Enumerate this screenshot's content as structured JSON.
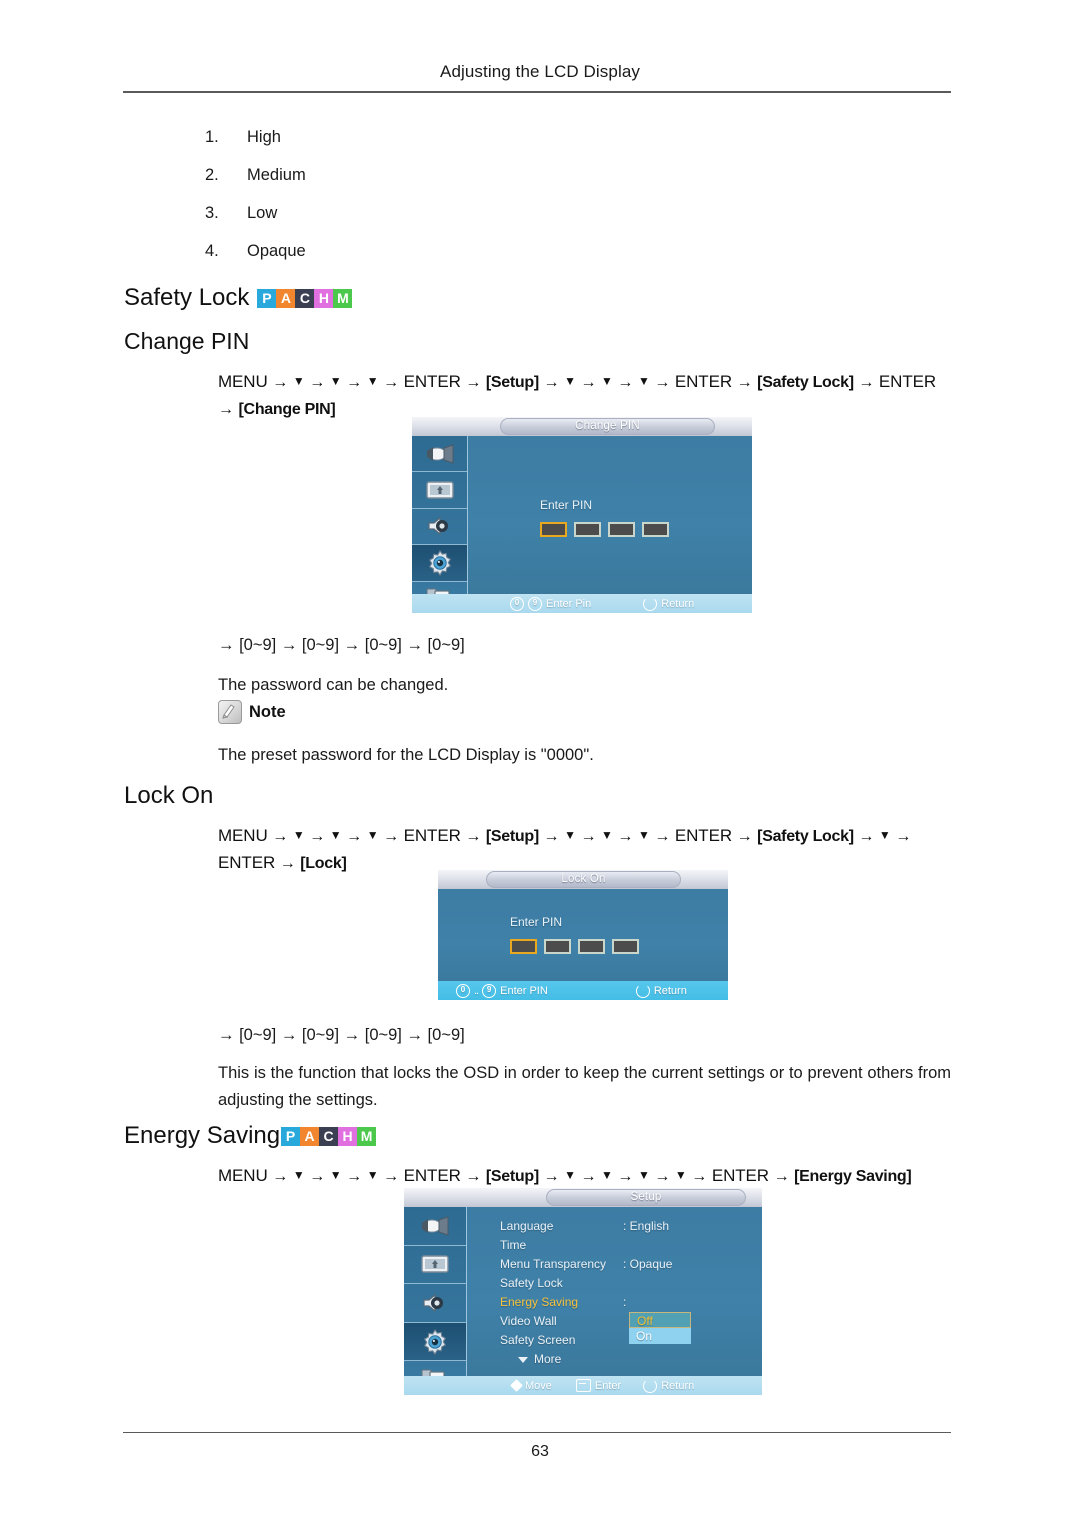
{
  "header": {
    "title": "Adjusting the LCD Display"
  },
  "footer": {
    "page_number": "63"
  },
  "numbered_list": [
    {
      "index": "1.",
      "label": "High"
    },
    {
      "index": "2.",
      "label": "Medium"
    },
    {
      "index": "3.",
      "label": "Low"
    },
    {
      "index": "4.",
      "label": "Opaque"
    }
  ],
  "badges": {
    "letters": [
      "P",
      "A",
      "C",
      "H",
      "M"
    ],
    "colors": [
      "#29a8dc",
      "#f2862e",
      "#3b3f52",
      "#e06fe0",
      "#4cc84c"
    ]
  },
  "sections": {
    "safety_lock": {
      "heading": "Safety Lock",
      "subheading": "Change PIN",
      "menu_path": {
        "line1": [
          {
            "t": "MENU",
            "k": "kw"
          },
          {
            "t": "→",
            "k": "arw"
          },
          {
            "t": "▼",
            "k": "dn"
          },
          {
            "t": "→",
            "k": "arw"
          },
          {
            "t": "▼",
            "k": "dn"
          },
          {
            "t": "→",
            "k": "arw"
          },
          {
            "t": "▼",
            "k": "dn"
          },
          {
            "t": "→",
            "k": "arw"
          },
          {
            "t": "ENTER",
            "k": "kw"
          },
          {
            "t": "→",
            "k": "arw"
          },
          {
            "t": "[Setup]",
            "k": "brk"
          },
          {
            "t": "→",
            "k": "arw"
          },
          {
            "t": "▼",
            "k": "dn"
          },
          {
            "t": "→",
            "k": "arw"
          },
          {
            "t": "▼",
            "k": "dn"
          },
          {
            "t": "→",
            "k": "arw"
          },
          {
            "t": "▼",
            "k": "dn"
          },
          {
            "t": "→",
            "k": "arw"
          },
          {
            "t": "ENTER",
            "k": "kw"
          },
          {
            "t": "→",
            "k": "arw"
          },
          {
            "t": "[Safety Lock]",
            "k": "brk"
          },
          {
            "t": "→",
            "k": "arw"
          },
          {
            "t": "ENTER",
            "k": "kw"
          }
        ],
        "line2": [
          {
            "t": "→",
            "k": "arw"
          },
          {
            "t": "[Change PIN]",
            "k": "brk"
          }
        ]
      },
      "range_line": "→ [0~9] → [0~9] → [0~9] → [0~9]",
      "description": "The password can be changed.",
      "note_label": "Note",
      "note_text": "The preset password for the LCD Display is \"0000\"."
    },
    "lock_on": {
      "heading": "Lock On",
      "menu_path": {
        "line1": [
          {
            "t": "MENU",
            "k": "kw"
          },
          {
            "t": "→",
            "k": "arw"
          },
          {
            "t": "▼",
            "k": "dn"
          },
          {
            "t": "→",
            "k": "arw"
          },
          {
            "t": "▼",
            "k": "dn"
          },
          {
            "t": "→",
            "k": "arw"
          },
          {
            "t": "▼",
            "k": "dn"
          },
          {
            "t": "→",
            "k": "arw"
          },
          {
            "t": "ENTER",
            "k": "kw"
          },
          {
            "t": "→",
            "k": "arw"
          },
          {
            "t": "[Setup]",
            "k": "brk"
          },
          {
            "t": "→",
            "k": "arw"
          },
          {
            "t": "▼",
            "k": "dn"
          },
          {
            "t": "→",
            "k": "arw"
          },
          {
            "t": "▼",
            "k": "dn"
          },
          {
            "t": "→",
            "k": "arw"
          },
          {
            "t": "▼",
            "k": "dn"
          },
          {
            "t": "→",
            "k": "arw"
          },
          {
            "t": "ENTER",
            "k": "kw"
          },
          {
            "t": "→",
            "k": "arw"
          },
          {
            "t": "[Safety Lock]",
            "k": "brk"
          },
          {
            "t": "→",
            "k": "arw"
          },
          {
            "t": "▼",
            "k": "dn"
          },
          {
            "t": "→",
            "k": "arw"
          }
        ],
        "line2": [
          {
            "t": "ENTER",
            "k": "kw"
          },
          {
            "t": "→",
            "k": "arw"
          },
          {
            "t": "[Lock]",
            "k": "brk"
          }
        ]
      },
      "range_line": "→ [0~9] → [0~9] → [0~9] → [0~9]",
      "description": "This is the function that locks the OSD in order to keep the current settings or to prevent others from adjusting the settings."
    },
    "energy_saving": {
      "heading": "Energy Saving",
      "menu_path": {
        "line1": [
          {
            "t": "MENU",
            "k": "kw"
          },
          {
            "t": "→",
            "k": "arw"
          },
          {
            "t": "▼",
            "k": "dn"
          },
          {
            "t": "→",
            "k": "arw"
          },
          {
            "t": "▼",
            "k": "dn"
          },
          {
            "t": "→",
            "k": "arw"
          },
          {
            "t": "▼",
            "k": "dn"
          },
          {
            "t": "→",
            "k": "arw"
          },
          {
            "t": "ENTER",
            "k": "kw"
          },
          {
            "t": "→",
            "k": "arw"
          },
          {
            "t": "[Setup]",
            "k": "brk"
          },
          {
            "t": "→",
            "k": "arw"
          },
          {
            "t": "▼",
            "k": "dn"
          },
          {
            "t": "→",
            "k": "arw"
          },
          {
            "t": "▼",
            "k": "dn"
          },
          {
            "t": "→",
            "k": "arw"
          },
          {
            "t": "▼",
            "k": "dn"
          },
          {
            "t": "→",
            "k": "arw"
          },
          {
            "t": "▼",
            "k": "dn"
          },
          {
            "t": "→",
            "k": "arw"
          },
          {
            "t": "ENTER",
            "k": "kw"
          },
          {
            "t": "→",
            "k": "arw"
          },
          {
            "t": "[Energy Saving]",
            "k": "brk"
          }
        ]
      }
    }
  },
  "osd_change_pin": {
    "title": "Change PIN",
    "pin_label": "Enter PIN",
    "pin_boxes": 4,
    "selected_box": 0,
    "footer": [
      {
        "icon": "digit-0-key",
        "icon2": "digit-9-key",
        "label": "Enter Pin"
      },
      {
        "icon": "return-arrow-icon",
        "label": "Return"
      }
    ]
  },
  "osd_lock_on": {
    "title": "Lock On",
    "pin_label": "Enter PIN",
    "pin_boxes": 4,
    "selected_box": 0,
    "footer": [
      {
        "icon": "digit-range-key",
        "label": "Enter PIN"
      },
      {
        "icon": "return-arrow-icon",
        "label": "Return"
      }
    ]
  },
  "osd_setup": {
    "title": "Setup",
    "rows": [
      {
        "name": "Language",
        "value": ": English",
        "highlight": false
      },
      {
        "name": "Time",
        "value": "",
        "highlight": false
      },
      {
        "name": "Menu Transparency",
        "value": ": Opaque",
        "highlight": false
      },
      {
        "name": "Safety Lock",
        "value": "",
        "highlight": false
      },
      {
        "name": "Energy Saving",
        "value": ":",
        "highlight": true
      },
      {
        "name": "Video Wall",
        "value": "",
        "highlight": false
      },
      {
        "name": "Safety Screen",
        "value": "",
        "highlight": false
      }
    ],
    "more_label": "More",
    "dropdown": [
      {
        "label": "Off",
        "selected": true
      },
      {
        "label": "On",
        "selected": false
      }
    ],
    "footer": [
      {
        "icon": "move-diamond-icon",
        "label": "Move"
      },
      {
        "icon": "enter-key-icon",
        "label": "Enter"
      },
      {
        "icon": "return-arrow-icon",
        "label": "Return"
      }
    ]
  }
}
